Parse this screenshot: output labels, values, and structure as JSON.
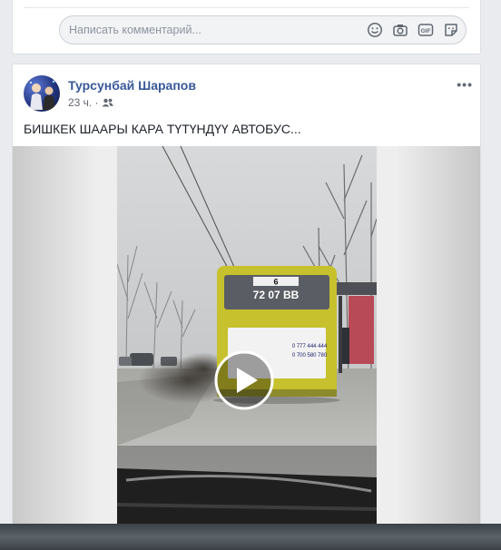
{
  "comment": {
    "placeholder": "Написать комментарий...",
    "icons": [
      "emoji-icon",
      "camera-icon",
      "gif-icon",
      "sticker-icon"
    ]
  },
  "post": {
    "author": "Турсунбай Шарапов",
    "time": "23 ч.",
    "audience_icon": "friends-icon",
    "more_label": "•••",
    "text": "БИШКЕК ШААРЫ КАРА ТҮТҮНДҮҮ АВТОБУС...",
    "video": {
      "bus_route": "6",
      "bus_plate": "72 07 BB",
      "ad_phone_1": "0 777 444 444",
      "ad_phone_2": "0 700 580 780"
    }
  }
}
